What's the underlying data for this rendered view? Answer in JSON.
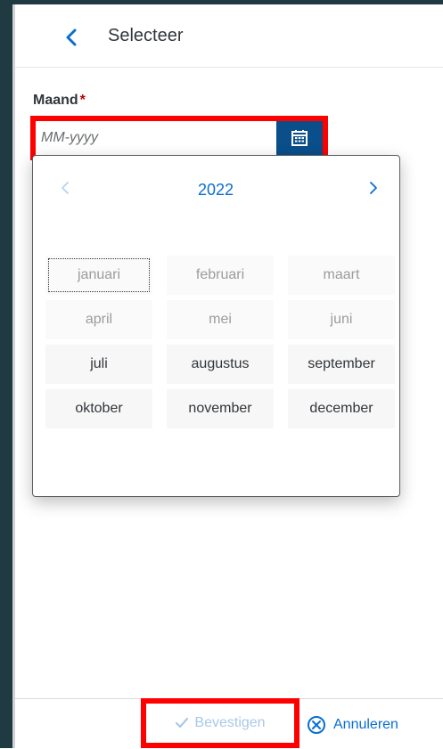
{
  "header": {
    "title": "Selecteer",
    "back_icon": "chevron-left-icon"
  },
  "form": {
    "month_label": "Maand",
    "required_marker": "*",
    "month_placeholder": "MM-yyyy",
    "month_value": "",
    "calendar_icon": "calendar-icon"
  },
  "picker": {
    "year": "2022",
    "prev_icon": "chevron-left-icon",
    "next_icon": "chevron-right-icon",
    "months": [
      {
        "label": "januari",
        "state": "disabled",
        "focused": true
      },
      {
        "label": "februari",
        "state": "disabled"
      },
      {
        "label": "maart",
        "state": "disabled"
      },
      {
        "label": "april",
        "state": "disabled"
      },
      {
        "label": "mei",
        "state": "disabled"
      },
      {
        "label": "juni",
        "state": "disabled"
      },
      {
        "label": "juli",
        "state": "enabled"
      },
      {
        "label": "augustus",
        "state": "enabled"
      },
      {
        "label": "september",
        "state": "enabled"
      },
      {
        "label": "oktober",
        "state": "enabled"
      },
      {
        "label": "november",
        "state": "enabled"
      },
      {
        "label": "december",
        "state": "enabled"
      }
    ]
  },
  "footer": {
    "confirm_label": "Bevestigen",
    "confirm_state": "disabled",
    "cancel_label": "Annuleren",
    "confirm_icon": "checkmark-icon",
    "cancel_icon": "circle-x-icon"
  },
  "colors": {
    "accent": "#0a6ed1",
    "highlight": "#ff0000",
    "required": "#bb0000"
  }
}
